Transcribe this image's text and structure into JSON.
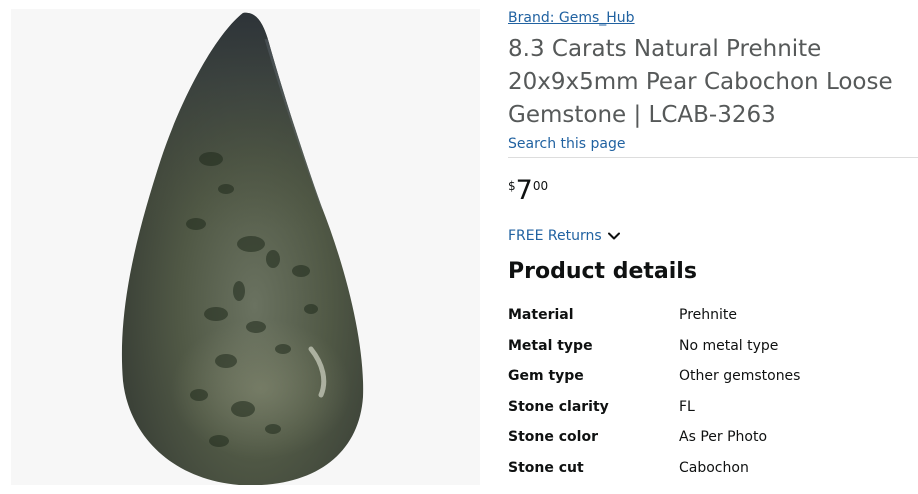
{
  "product": {
    "brand_link": "Brand: Gems_Hub",
    "title": "8.3 Carats Natural Prehnite 20x9x5mm Pear Cabochon Loose Gemstone | LCAB-3263",
    "search_link": "Search this page",
    "image_icon": "prehnite-pear-cabochon-photo"
  },
  "price": {
    "symbol": "$",
    "whole": "7",
    "fraction": "00"
  },
  "returns": {
    "label": "FREE Returns",
    "icon": "chevron-down-icon"
  },
  "details": {
    "heading": "Product details",
    "rows": [
      {
        "label": "Material",
        "value": "Prehnite"
      },
      {
        "label": "Metal type",
        "value": "No metal type"
      },
      {
        "label": "Gem type",
        "value": "Other gemstones"
      },
      {
        "label": "Stone clarity",
        "value": "FL"
      },
      {
        "label": "Stone color",
        "value": "As Per Photo"
      },
      {
        "label": "Stone cut",
        "value": "Cabochon"
      }
    ]
  },
  "colors": {
    "link": "#2162a1",
    "title_gray": "#565959",
    "text": "#0f1111",
    "image_bg": "#f7f7f7",
    "gem_body": "#4d5440",
    "gem_top": "#2b3137"
  }
}
